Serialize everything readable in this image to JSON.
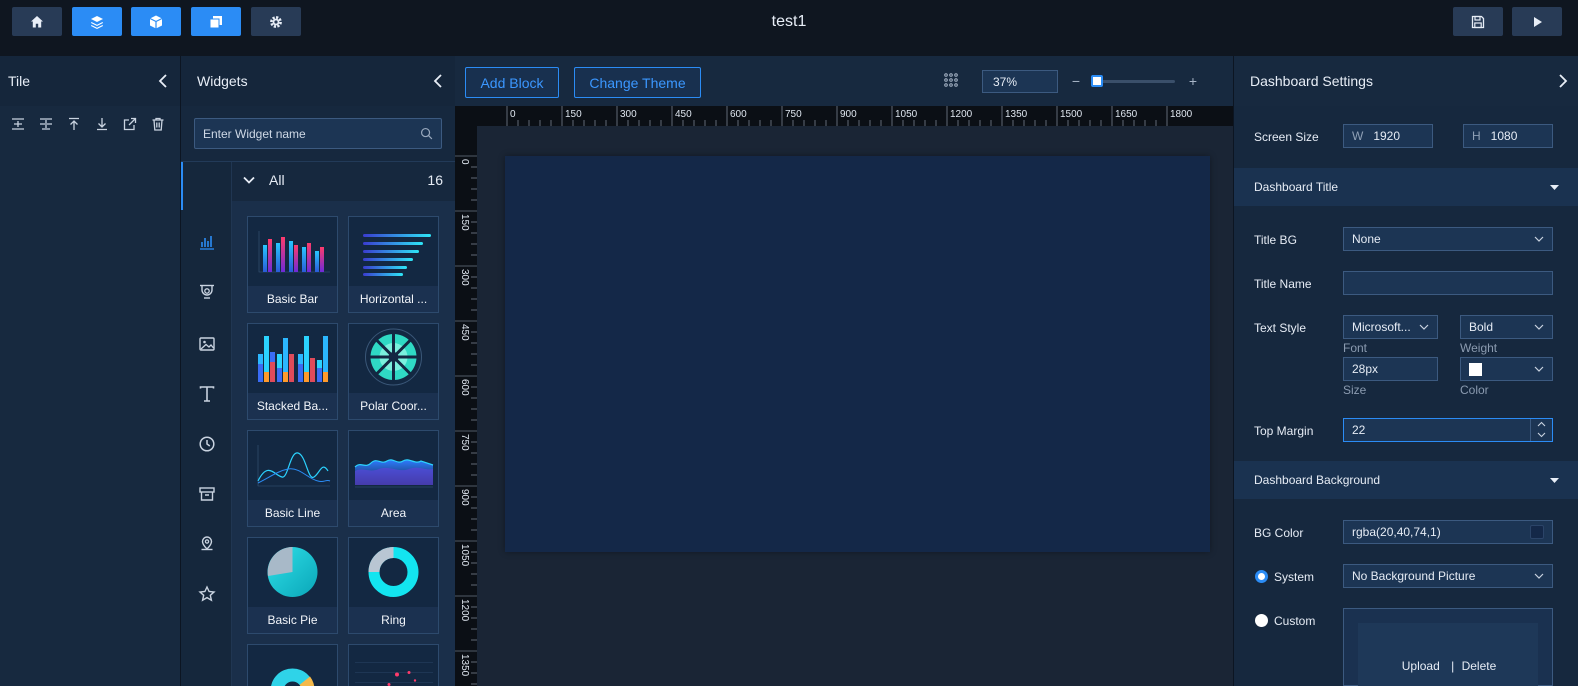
{
  "app": {
    "title": "test1"
  },
  "toolbar": {
    "buttons": [
      {
        "name": "home",
        "icon": "home-icon"
      },
      {
        "name": "layers",
        "icon": "layers-icon"
      },
      {
        "name": "cube",
        "icon": "cube-icon"
      },
      {
        "name": "copy",
        "icon": "copy-icon"
      },
      {
        "name": "settings",
        "icon": "gear-icon"
      }
    ],
    "right": [
      {
        "name": "save",
        "icon": "save-icon"
      },
      {
        "name": "preview",
        "icon": "play-icon"
      }
    ]
  },
  "tile": {
    "title": "Tile",
    "tools": [
      "align-center-icon",
      "align-middle-icon",
      "move-top-icon",
      "move-bottom-icon",
      "export-icon",
      "delete-icon"
    ]
  },
  "widgets": {
    "title": "Widgets",
    "search_placeholder": "Enter Widget name",
    "group_label": "All",
    "group_count": "16",
    "categories": [
      "chart-icon",
      "map-pin-icon",
      "image-icon",
      "text-icon",
      "clock-icon",
      "box-icon",
      "location-icon",
      "star-icon"
    ],
    "items": [
      {
        "label": "Basic Bar"
      },
      {
        "label": "Horizontal ..."
      },
      {
        "label": "Stacked Ba..."
      },
      {
        "label": "Polar Coor..."
      },
      {
        "label": "Basic Line"
      },
      {
        "label": "Area"
      },
      {
        "label": "Basic Pie"
      },
      {
        "label": "Ring"
      }
    ]
  },
  "center": {
    "add_block": "Add Block",
    "change_theme": "Change Theme",
    "zoom": "37%",
    "zoom_minus": "−",
    "zoom_plus": "+",
    "ruler_h": [
      "0",
      "150",
      "300",
      "450",
      "600",
      "750",
      "900",
      "1050",
      "1200",
      "1350",
      "1500",
      "1650",
      "1800"
    ],
    "ruler_v": [
      "0",
      "150",
      "300",
      "450",
      "600",
      "750",
      "900",
      "1050",
      "1200",
      "1350"
    ]
  },
  "settings": {
    "title": "Dashboard Settings",
    "screen_size_label": "Screen Size",
    "width_prefix": "W",
    "width": "1920",
    "height_prefix": "H",
    "height": "1080",
    "title_section": "Dashboard Title",
    "title_bg_label": "Title BG",
    "title_bg_value": "None",
    "title_name_label": "Title Name",
    "title_name_value": "",
    "text_style_label": "Text Style",
    "font_value": "Microsoft...",
    "font_label": "Font",
    "weight_value": "Bold",
    "weight_label": "Weight",
    "size_value": "28px",
    "size_label": "Size",
    "color_label": "Color",
    "top_margin_label": "Top Margin",
    "top_margin_value": "22",
    "bg_section": "Dashboard Background",
    "bg_color_label": "BG Color",
    "bg_color_value": "rgba(20,40,74,1)",
    "system_label": "System",
    "system_value": "No Background Picture",
    "custom_label": "Custom",
    "upload": "Upload",
    "separator": "|",
    "delete": "Delete"
  },
  "colors": {
    "accent": "#2b8cf5",
    "canvas": "#142848",
    "panel": "#16283e"
  }
}
